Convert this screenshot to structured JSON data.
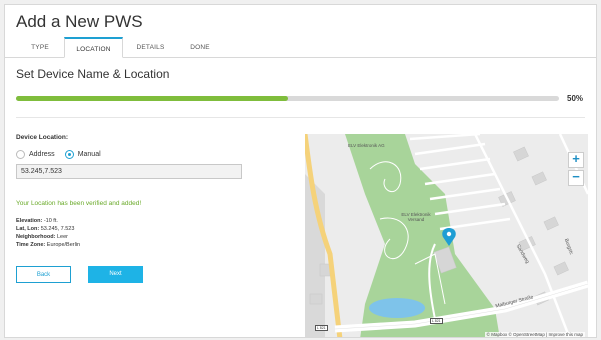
{
  "header": {
    "title": "Add a New PWS"
  },
  "tabs": [
    {
      "label": "TYPE"
    },
    {
      "label": "LOCATION"
    },
    {
      "label": "DETAILS"
    },
    {
      "label": "DONE"
    }
  ],
  "section_title": "Set Device Name & Location",
  "progress": {
    "value": 0.5,
    "label": "50%"
  },
  "form": {
    "device_location_label": "Device Location:",
    "radio_address": "Address",
    "radio_manual": "Manual",
    "coordinates": "53.245,7.523",
    "verified_message": "Your Location has been verified and added!",
    "elevation_label": "Elevation:",
    "elevation_value": "-10 ft.",
    "latlon_label": "Lat, Lon:",
    "latlon_value": "53.245, 7.523",
    "neighborhood_label": "Neighborhood:",
    "neighborhood_value": "Leer",
    "timezone_label": "Time Zone:",
    "timezone_value": "Europe/Berlin",
    "back_label": "Back",
    "next_label": "Next"
  },
  "map": {
    "zoom_in": "+",
    "zoom_out": "−",
    "poi_top": "ELV Elektronik AG",
    "poi_center": "ELV Elektronik Versand",
    "street_main": "Maiburger Straße",
    "street_side1": "Sandweg",
    "street_side2": "Burgstr.",
    "road_sign_1": "L 821",
    "road_sign_2": "L 821",
    "attribution": "© Mapbox © OpenStreetMap | Improve this map",
    "colors": {
      "park": "#a8d49a",
      "water": "#7ec3ea",
      "marker": "#1e9ed4",
      "road": "#f5d27a"
    }
  }
}
